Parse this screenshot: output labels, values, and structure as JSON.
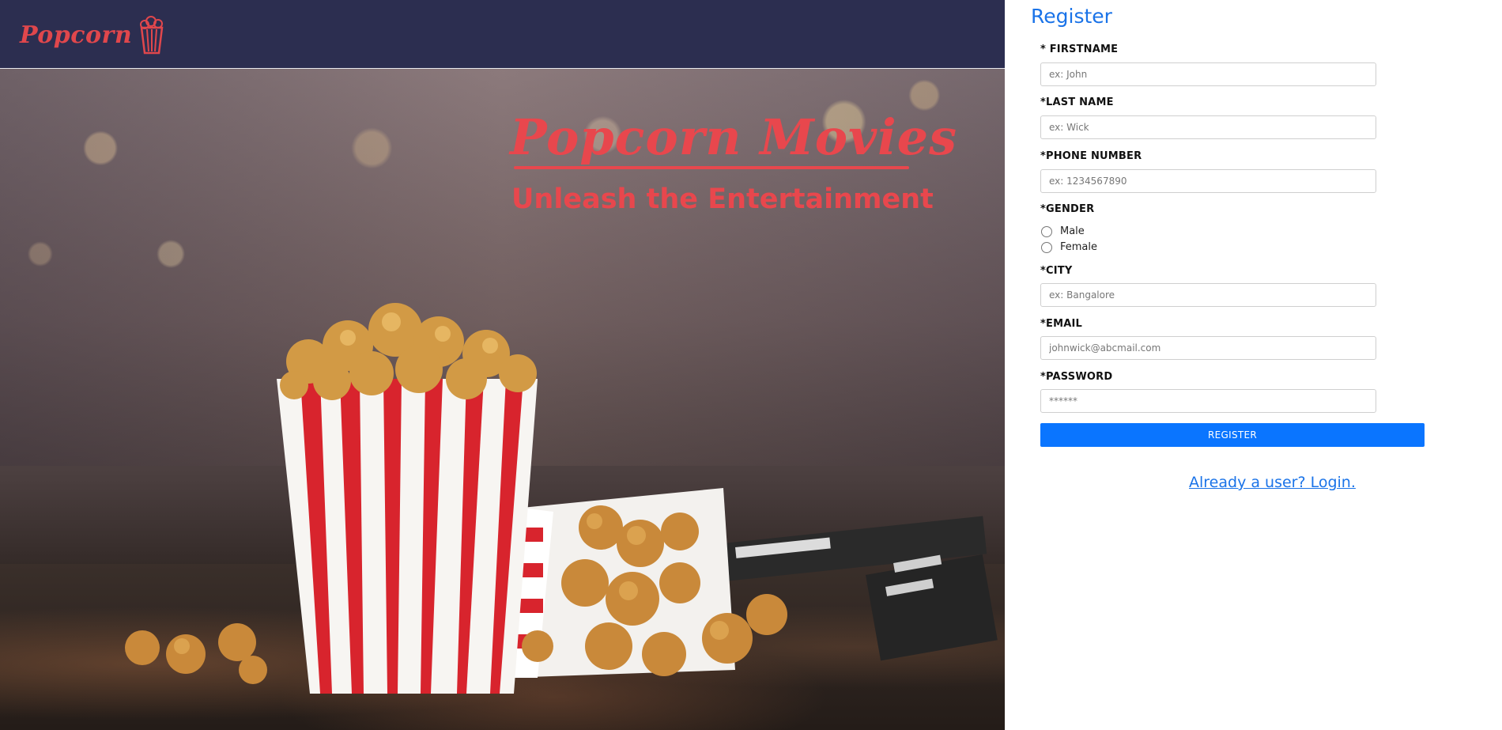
{
  "brand": {
    "name": "Popcorn",
    "icon": "popcorn-bucket-icon",
    "color": "#e0474c"
  },
  "hero": {
    "title": "Popcorn Movies",
    "tagline": "Unleash the Entertainment",
    "accent_color": "#e8474d"
  },
  "form": {
    "title": "Register",
    "fields": {
      "firstname": {
        "label": "* FIRSTNAME",
        "placeholder": "ex: John"
      },
      "lastname": {
        "label": "*LAST NAME",
        "placeholder": "ex: Wick"
      },
      "phone": {
        "label": "*PHONE NUMBER",
        "placeholder": "ex: 1234567890"
      },
      "gender": {
        "label": "*GENDER",
        "options": [
          "Male",
          "Female"
        ]
      },
      "city": {
        "label": "*CITY",
        "placeholder": "ex: Bangalore"
      },
      "email": {
        "label": "*EMAIL",
        "placeholder": "johnwick@abcmail.com"
      },
      "password": {
        "label": "*PASSWORD",
        "placeholder": "******"
      }
    },
    "submit_label": "REGISTER",
    "login_link": "Already a user? Login."
  },
  "colors": {
    "navbar": "#2c2e50",
    "primary": "#0a75ff",
    "link": "#1a73e8"
  }
}
